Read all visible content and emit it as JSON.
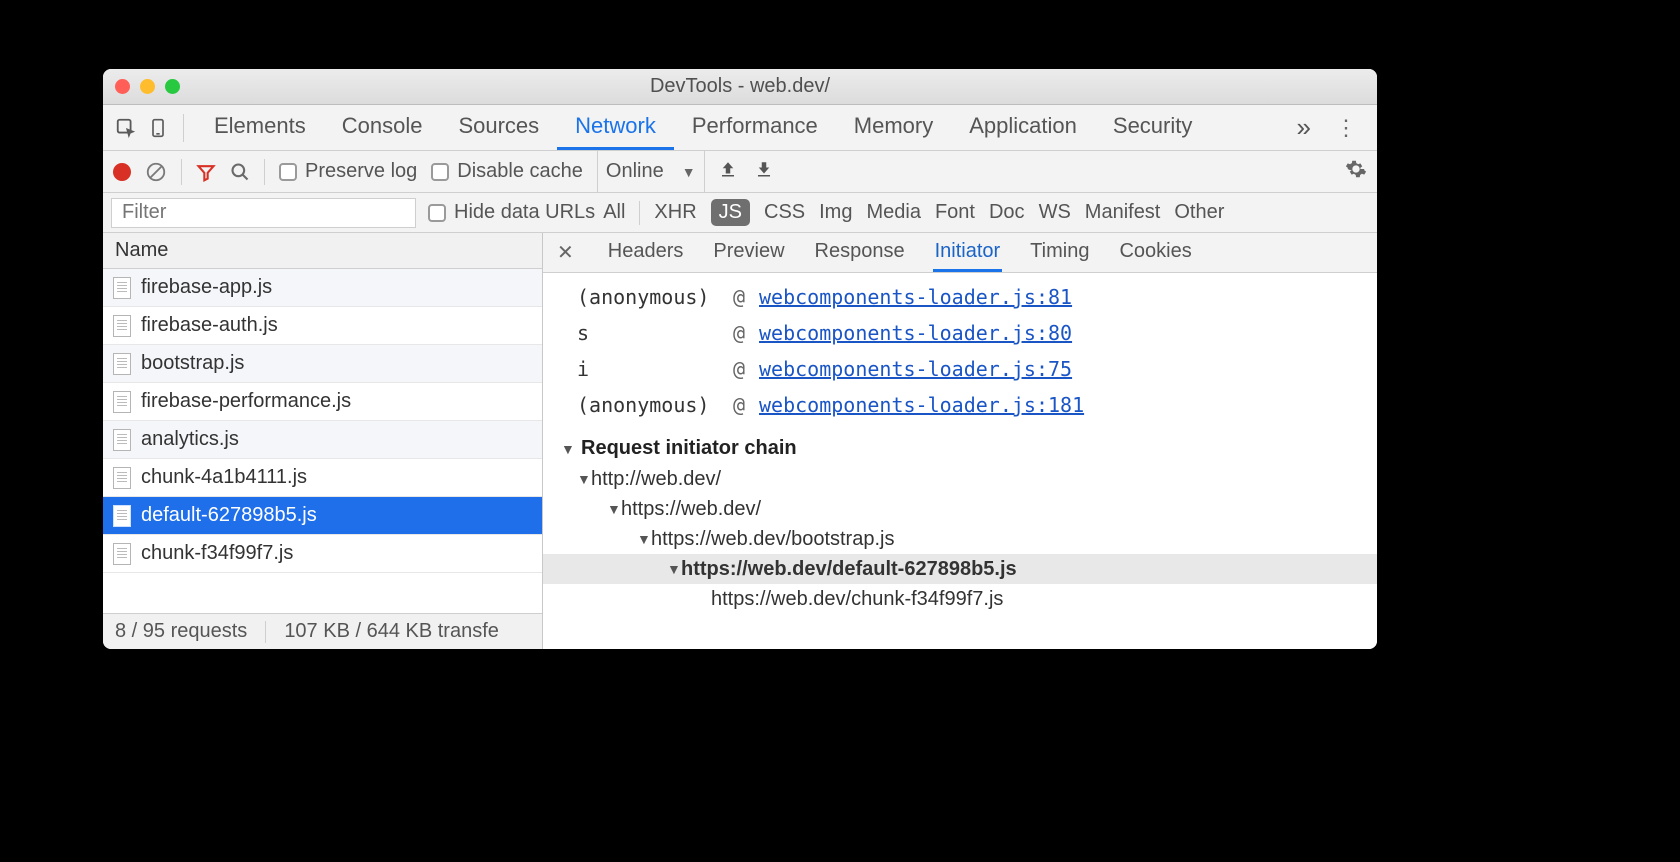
{
  "window": {
    "title": "DevTools - web.dev/"
  },
  "panelTabs": [
    "Elements",
    "Console",
    "Sources",
    "Network",
    "Performance",
    "Memory",
    "Application",
    "Security"
  ],
  "panelActiveIndex": 3,
  "toolbar": {
    "preserve_log": "Preserve log",
    "disable_cache": "Disable cache",
    "throttling": "Online"
  },
  "filterRow": {
    "placeholder": "Filter",
    "hide_data_urls": "Hide data URLs",
    "all": "All",
    "types": [
      "XHR",
      "JS",
      "CSS",
      "Img",
      "Media",
      "Font",
      "Doc",
      "WS",
      "Manifest",
      "Other"
    ],
    "active_type_index": 1
  },
  "columns": {
    "name": "Name"
  },
  "requests": [
    {
      "name": "firebase-app.js",
      "cut": true
    },
    {
      "name": "firebase-auth.js"
    },
    {
      "name": "bootstrap.js"
    },
    {
      "name": "firebase-performance.js"
    },
    {
      "name": "analytics.js"
    },
    {
      "name": "chunk-4a1b4111.js"
    },
    {
      "name": "default-627898b5.js",
      "selected": true
    },
    {
      "name": "chunk-f34f99f7.js"
    }
  ],
  "status": {
    "requests": "8 / 95 requests",
    "transfer": "107 KB / 644 KB transfe"
  },
  "detailTabs": [
    "Headers",
    "Preview",
    "Response",
    "Initiator",
    "Timing",
    "Cookies"
  ],
  "detailActiveIndex": 3,
  "stack": [
    {
      "fn": "(anonymous)",
      "link": "webcomponents-loader.js:81"
    },
    {
      "fn": "s",
      "link": "webcomponents-loader.js:80"
    },
    {
      "fn": "i",
      "link": "webcomponents-loader.js:75"
    },
    {
      "fn": "(anonymous)",
      "link": "webcomponents-loader.js:181"
    }
  ],
  "chain": {
    "heading": "Request initiator chain",
    "items": [
      {
        "indent": 0,
        "tri": true,
        "text": "http://web.dev/"
      },
      {
        "indent": 1,
        "tri": true,
        "text": "https://web.dev/"
      },
      {
        "indent": 2,
        "tri": true,
        "text": "https://web.dev/bootstrap.js"
      },
      {
        "indent": 3,
        "tri": true,
        "text": "https://web.dev/default-627898b5.js",
        "current": true
      },
      {
        "indent": 4,
        "tri": false,
        "text": "https://web.dev/chunk-f34f99f7.js"
      }
    ]
  }
}
